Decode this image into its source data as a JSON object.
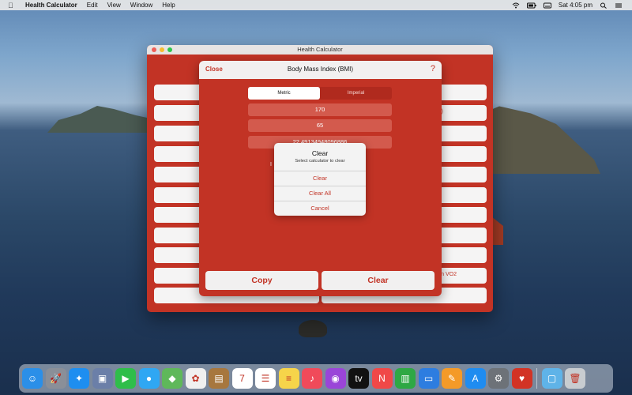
{
  "menubar": {
    "app_name": "Health Calculator",
    "items": [
      "Edit",
      "View",
      "Window",
      "Help"
    ],
    "clock": "Sat 4:05 pm"
  },
  "window": {
    "title": "Health Calculator"
  },
  "sheet": {
    "close_label": "Close",
    "title": "Body Mass Index (BMI)",
    "help_label": "?",
    "segments": [
      "Metric",
      "Imperial"
    ],
    "selected_segment": "Metric",
    "height_value": "170",
    "weight_value": "65",
    "result_value": "22.49134948096886",
    "partial_label": "I",
    "copy_label": "Copy",
    "clear_label": "Clear"
  },
  "background_partial": {
    "right_label_1": ")",
    "right_label_2": "n VO2"
  },
  "alert": {
    "title": "Clear",
    "message": "Select calculator to clear",
    "buttons": [
      "Clear",
      "Clear All",
      "Cancel"
    ]
  },
  "dock": {
    "apps": [
      {
        "name": "finder",
        "color": "#2b8fe8",
        "glyph": "☺"
      },
      {
        "name": "launchpad",
        "color": "#8a8f98",
        "glyph": "🚀"
      },
      {
        "name": "safari",
        "color": "#1e8ef0",
        "glyph": "✦"
      },
      {
        "name": "photos-app",
        "color": "#6b7fa8",
        "glyph": "▣"
      },
      {
        "name": "facetime",
        "color": "#2fbe4a",
        "glyph": "▶"
      },
      {
        "name": "messages",
        "color": "#2fa7f3",
        "glyph": "●"
      },
      {
        "name": "maps",
        "color": "#5fb85a",
        "glyph": "◆"
      },
      {
        "name": "photos",
        "color": "#f0f0f0",
        "glyph": "✿"
      },
      {
        "name": "contacts",
        "color": "#a7773e",
        "glyph": "▤"
      },
      {
        "name": "calendar",
        "color": "#ffffff",
        "glyph": "7"
      },
      {
        "name": "reminders",
        "color": "#ffffff",
        "glyph": "☰"
      },
      {
        "name": "notes",
        "color": "#f6d44a",
        "glyph": "≡"
      },
      {
        "name": "music",
        "color": "#f04a5a",
        "glyph": "♪"
      },
      {
        "name": "podcasts",
        "color": "#9a45d8",
        "glyph": "◉"
      },
      {
        "name": "tv",
        "color": "#111111",
        "glyph": "tv"
      },
      {
        "name": "news",
        "color": "#f04848",
        "glyph": "N"
      },
      {
        "name": "numbers",
        "color": "#2ea844",
        "glyph": "▥"
      },
      {
        "name": "keynote",
        "color": "#2d7de0",
        "glyph": "▭"
      },
      {
        "name": "pages",
        "color": "#f49a28",
        "glyph": "✎"
      },
      {
        "name": "app-store",
        "color": "#1f8cf0",
        "glyph": "A"
      },
      {
        "name": "system-preferences",
        "color": "#6d7278",
        "glyph": "⚙"
      },
      {
        "name": "health-calculator",
        "color": "#d23325",
        "glyph": "♥"
      },
      {
        "name": "downloads-folder",
        "color": "#5fb3e8",
        "glyph": "▢"
      },
      {
        "name": "trash",
        "color": "#c8ccd0",
        "glyph": "🗑"
      }
    ]
  }
}
